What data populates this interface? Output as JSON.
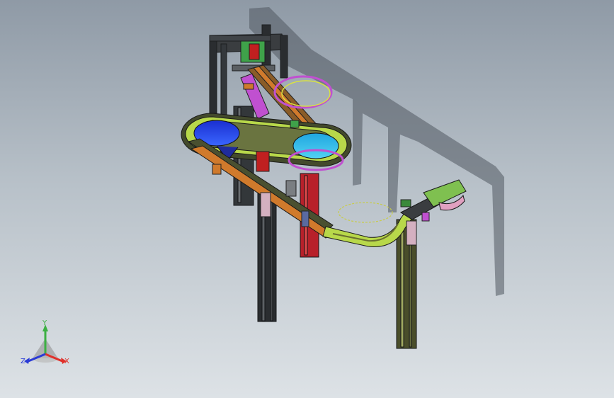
{
  "view": {
    "background_top": "#8f9aa6",
    "background_bottom": "#dde2e6",
    "model_name": ""
  },
  "triad": {
    "x_label": "X",
    "y_label": "Y",
    "z_label": "Z",
    "x_color": "#e0302a",
    "y_color": "#3cb043",
    "z_color": "#2a3bd6"
  },
  "model_colors": {
    "frame_dark": "#2a2d30",
    "frame_gray": "#8a8e92",
    "track_green": "#b8d84a",
    "track_orange": "#d07a2c",
    "bowl_blue": "#2a4de0",
    "bowl_cyan": "#29b8e6",
    "accent_magenta": "#c050d0",
    "accent_red": "#c02020"
  }
}
